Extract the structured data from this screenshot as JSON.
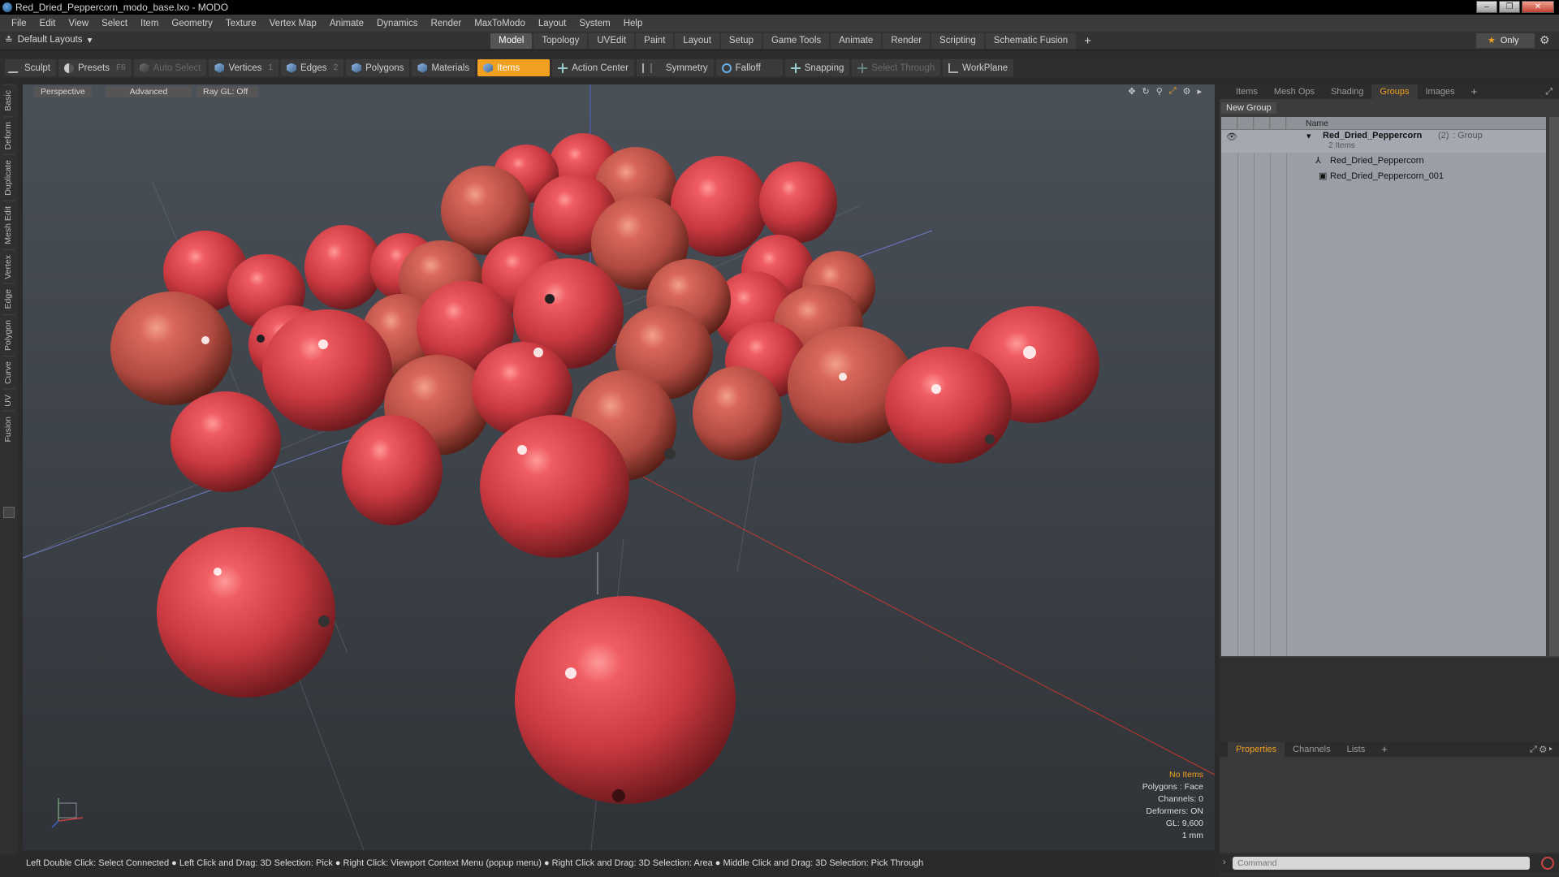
{
  "window": {
    "title": "Red_Dried_Peppercorn_modo_base.lxo - MODO",
    "controls": [
      "–",
      "❐",
      "✕"
    ]
  },
  "menu": [
    "File",
    "Edit",
    "View",
    "Select",
    "Item",
    "Geometry",
    "Texture",
    "Vertex Map",
    "Animate",
    "Dynamics",
    "Render",
    "MaxToModo",
    "Layout",
    "System",
    "Help"
  ],
  "layout": {
    "selector": "Default Layouts",
    "tabs": [
      "Model",
      "Topology",
      "UVEdit",
      "Paint",
      "Layout",
      "Setup",
      "Game Tools",
      "Animate",
      "Render",
      "Scripting",
      "Schematic Fusion"
    ],
    "active_tab": "Model",
    "only_label": "Only"
  },
  "toolbar": {
    "sculpt": "Sculpt",
    "presets": "Presets",
    "presets_key": "F6",
    "auto_select": "Auto Select",
    "vertices": "Vertices",
    "vertices_count": "1",
    "edges": "Edges",
    "edges_count": "2",
    "polygons": "Polygons",
    "materials": "Materials",
    "items": "Items",
    "action_center": "Action Center",
    "symmetry": "Symmetry",
    "falloff": "Falloff",
    "snapping": "Snapping",
    "select_through": "Select Through",
    "workplane": "WorkPlane"
  },
  "left_tabs": [
    "Basic",
    "Deform",
    "Duplicate",
    "Mesh Edit",
    "Vertex",
    "Edge",
    "Polygon",
    "Curve",
    "UV",
    "Fusion"
  ],
  "viewport": {
    "view_mode": "Perspective",
    "shading": "Advanced",
    "raygl": "Ray GL: Off",
    "info": {
      "no_items": "No Items",
      "polygons": "Polygons : Face",
      "channels": "Channels: 0",
      "deformers": "Deformers: ON",
      "gl": "GL: 9,600",
      "unit": "1 mm"
    }
  },
  "status_bar": "Left Double Click: Select Connected ● Left Click and Drag: 3D Selection: Pick ● Right Click: Viewport Context Menu (popup menu) ● Right Click and Drag: 3D Selection: Area ● Middle Click and Drag: 3D Selection: Pick Through",
  "right_panel": {
    "tabs": [
      "Items",
      "Mesh Ops",
      "Shading",
      "Groups",
      "Images"
    ],
    "active_tab": "Groups",
    "new_group": "New Group",
    "column_name": "Name",
    "group": {
      "name": "Red_Dried_Peppercorn",
      "count": "(2)",
      "type": ": Group",
      "subtitle": "2 Items"
    },
    "children": [
      "Red_Dried_Peppercorn",
      "Red_Dried_Peppercorn_001"
    ],
    "bottom_tabs": [
      "Properties",
      "Channels",
      "Lists"
    ],
    "bottom_active": "Properties",
    "command_placeholder": "Command"
  },
  "colors": {
    "accent": "#f0a020",
    "viewport_bg": "#3c4148",
    "peppercorn": "#d8454e"
  }
}
